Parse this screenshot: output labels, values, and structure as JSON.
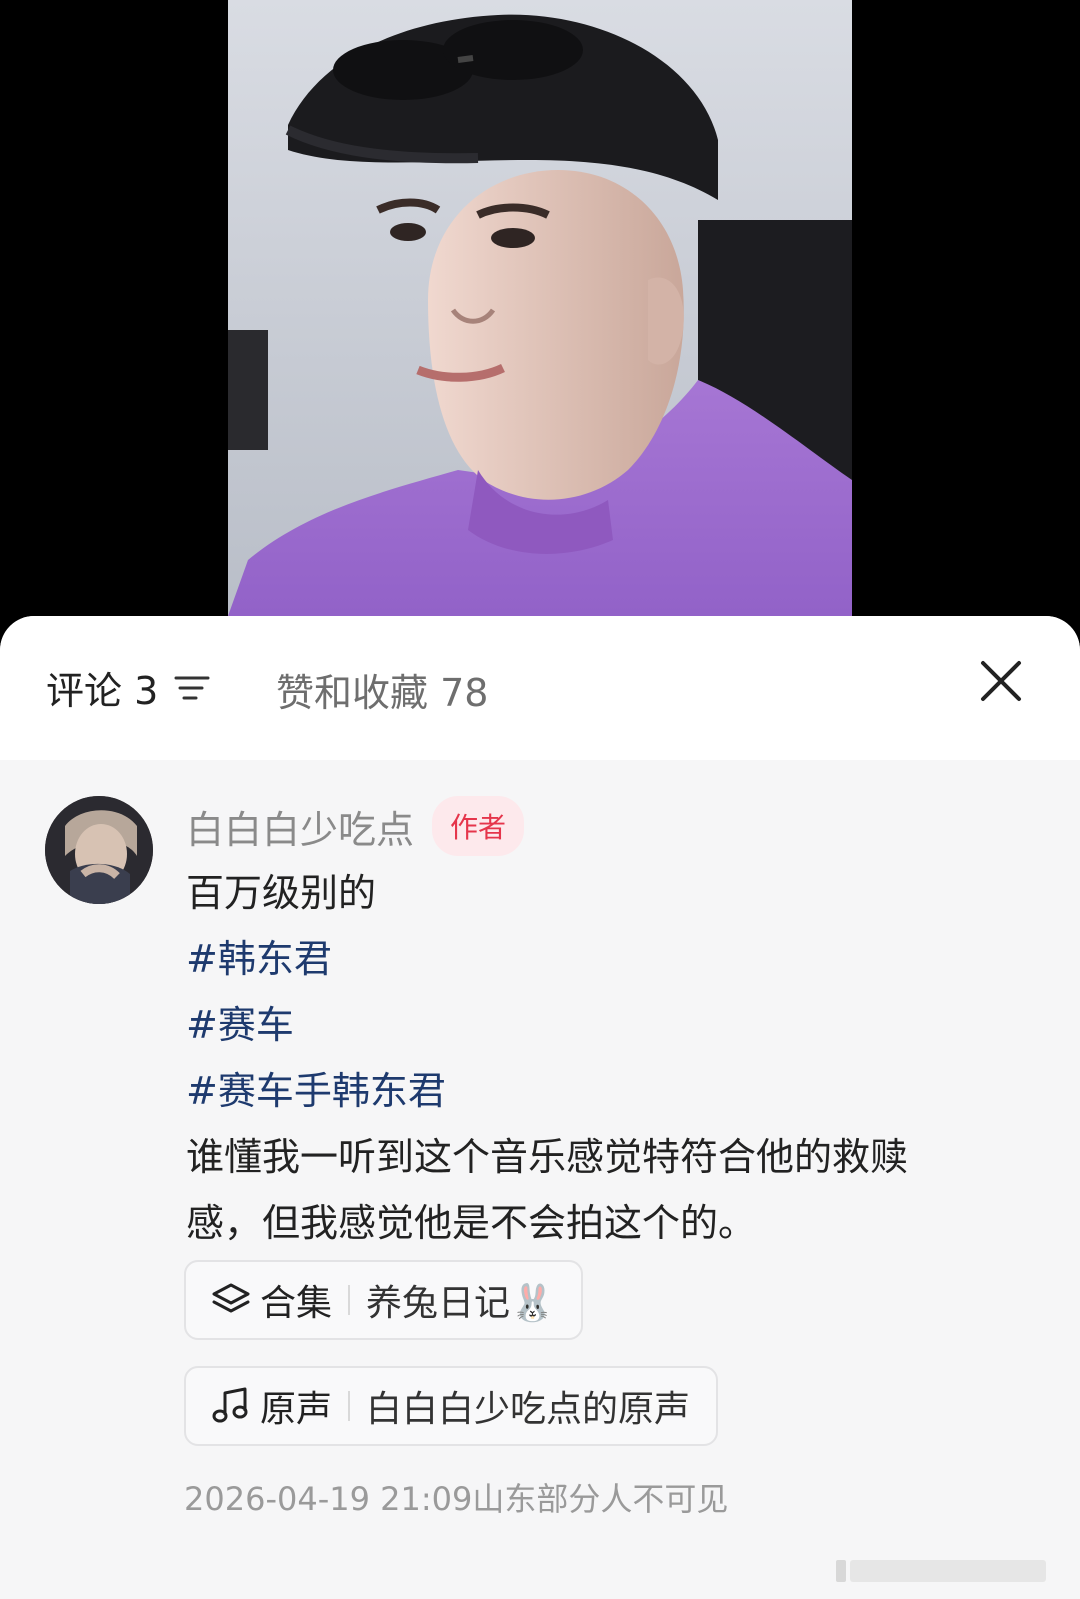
{
  "tabs": {
    "comments_label": "评论 3",
    "likes_label": "赞和收藏 78"
  },
  "comment": {
    "author": "白白白少吃点",
    "author_badge": "作者",
    "text_line1": "百万级别的",
    "hashtags": [
      "#韩东君",
      "#赛车",
      "#赛车手韩东君"
    ],
    "text_line2": "谁懂我一听到这个音乐感觉特符合他的救赎",
    "text_line3": "感，但我感觉他是不会拍这个的。",
    "collection": {
      "label": "合集",
      "value": "养兔日记🐰"
    },
    "sound": {
      "label": "原声",
      "value": "白白白少吃点的原声"
    },
    "timestamp": "2026-04-19 21:09",
    "location": "山东",
    "visibility": "部分人不可见"
  },
  "icons": {
    "sort": "sort-filter-icon",
    "close": "close-icon",
    "collection": "stack-layers-icon",
    "sound": "music-note-icon"
  },
  "colors": {
    "hashtag": "#1e3a6e",
    "badge_text": "#e5354b",
    "badge_bg": "#fde9ec",
    "sheet_bg": "#f6f6f7"
  }
}
